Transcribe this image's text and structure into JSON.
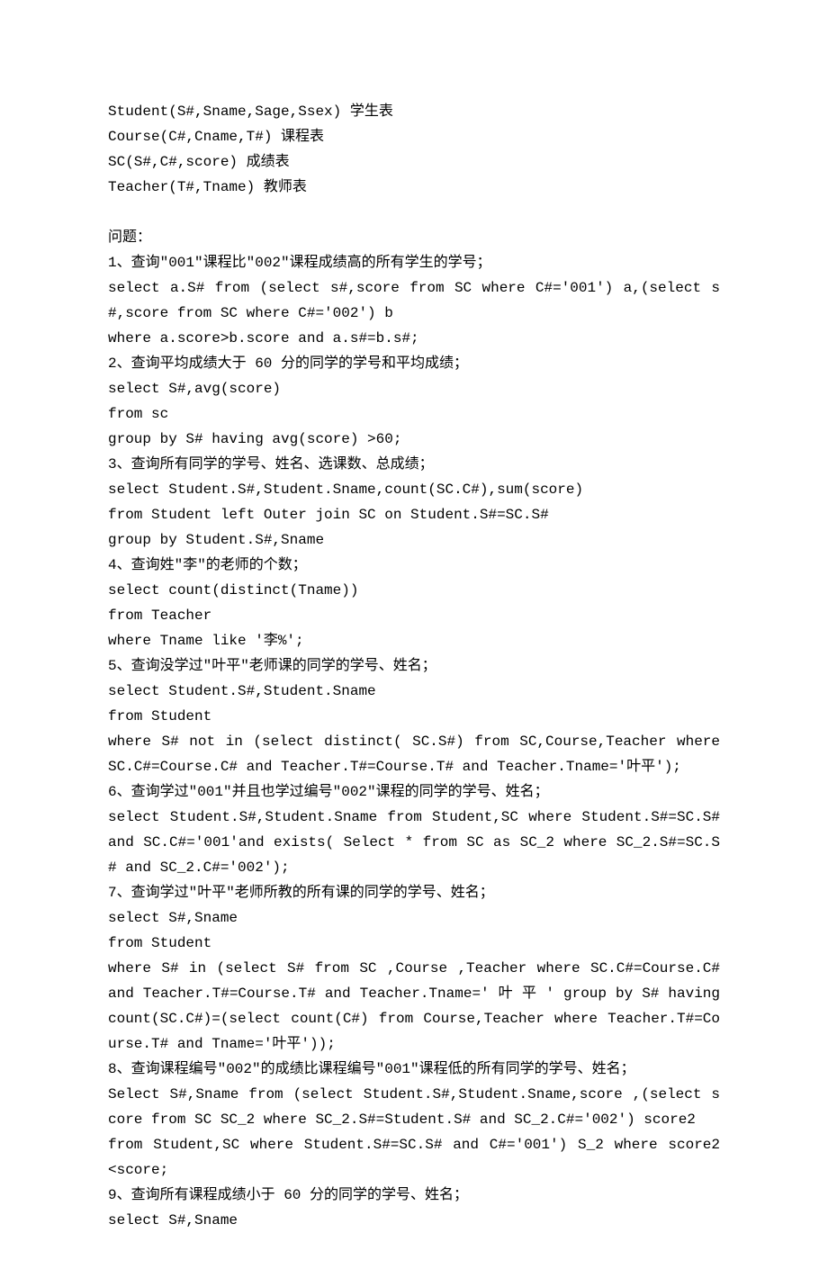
{
  "schema": {
    "student": "Student(S#,Sname,Sage,Ssex) 学生表",
    "course": "Course(C#,Cname,T#) 课程表",
    "sc": "SC(S#,C#,score) 成绩表",
    "teacher": "Teacher(T#,Tname) 教师表"
  },
  "questions_heading": "问题：",
  "q1": {
    "title": "1、查询\"001\"课程比\"002\"课程成绩高的所有学生的学号；",
    "sql1": "select a.S# from (select s#,score from SC where C#='001') a,(select s#,score from SC where C#='002') b",
    "sql2": "where a.score>b.score and a.s#=b.s#;"
  },
  "q2": {
    "title": "2、查询平均成绩大于 60 分的同学的学号和平均成绩；",
    "sql1": "select S#,avg(score)",
    "sql2": "from sc",
    "sql3": "group by S# having avg(score) >60;"
  },
  "q3": {
    "title": "3、查询所有同学的学号、姓名、选课数、总成绩；",
    "sql1": "select Student.S#,Student.Sname,count(SC.C#),sum(score)",
    "sql2": "from Student left Outer join SC on Student.S#=SC.S#",
    "sql3": "group by Student.S#,Sname"
  },
  "q4": {
    "title": "4、查询姓\"李\"的老师的个数；",
    "sql1": "select count(distinct(Tname))",
    "sql2": "from Teacher",
    "sql3": "where Tname like '李%';"
  },
  "q5": {
    "title": "5、查询没学过\"叶平\"老师课的同学的学号、姓名；",
    "sql1": "select Student.S#,Student.Sname",
    "sql2": "from Student",
    "sql3": "where S# not in (select distinct( SC.S#) from SC,Course,Teacher where  SC.C#=Course.C# and Teacher.T#=Course.T# and Teacher.Tname='叶平');"
  },
  "q6": {
    "title": "6、查询学过\"001\"并且也学过编号\"002\"课程的同学的学号、姓名；",
    "sql1": "select Student.S#,Student.Sname from Student,SC where Student.S#=SC.S# and SC.C#='001'and exists( Select * from SC as SC_2 where SC_2.S#=SC.S# and SC_2.C#='002');"
  },
  "q7": {
    "title": "7、查询学过\"叶平\"老师所教的所有课的同学的学号、姓名；",
    "sql1": "select S#,Sname",
    "sql2": "from Student",
    "sql3": "where S# in (select S# from SC ,Course ,Teacher where SC.C#=Course.C# and Teacher.T#=Course.T# and Teacher.Tname=' 叶 平 ' group by S# having count(SC.C#)=(select count(C#) from Course,Teacher where Teacher.T#=Course.T# and Tname='叶平'));"
  },
  "q8": {
    "title": "8、查询课程编号\"002\"的成绩比课程编号\"001\"课程低的所有同学的学号、姓名；",
    "sql1": "Select S#,Sname from (select Student.S#,Student.Sname,score ,(select score from SC SC_2 where SC_2.S#=Student.S# and SC_2.C#='002') score2",
    "sql2": "from Student,SC where Student.S#=SC.S# and C#='001') S_2 where score2 <score;"
  },
  "q9": {
    "title": "9、查询所有课程成绩小于 60 分的同学的学号、姓名；",
    "sql1": "select S#,Sname"
  }
}
